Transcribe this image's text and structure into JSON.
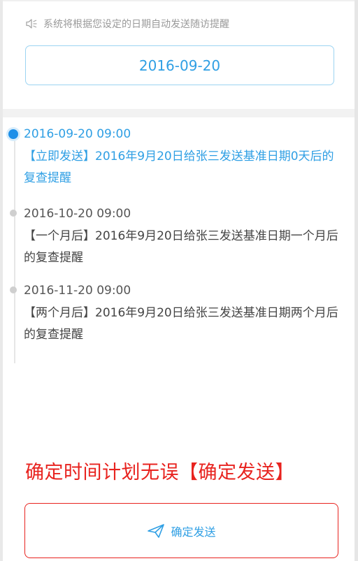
{
  "notice": {
    "icon": "speaker-icon",
    "text": "系统将根据您设定的日期自动发送随访提醒"
  },
  "date_selector": {
    "value": "2016-09-20"
  },
  "timeline": [
    {
      "time": "2016-09-20  09:00",
      "description": "【立即发送】2016年9月20日给张三发送基准日期0天后的复查提醒",
      "active": true
    },
    {
      "time": "2016-10-20  09:00",
      "description": "【一个月后】2016年9月20日给张三发送基准日期一个月后的复查提醒",
      "active": false
    },
    {
      "time": "2016-11-20  09:00",
      "description": "【两个月后】2016年9月20日给张三发送基准日期两个月后的复查提醒",
      "active": false
    }
  ],
  "hint": {
    "text": "确定时间计划无误【确定发送】"
  },
  "confirm_button": {
    "icon": "paper-plane-icon",
    "label": "确定发送"
  },
  "colors": {
    "accent_blue": "#2f9fe4",
    "dot_active": "#1d8fe8",
    "alert_red": "#e8231f",
    "muted_gray": "#9a9a9a"
  }
}
